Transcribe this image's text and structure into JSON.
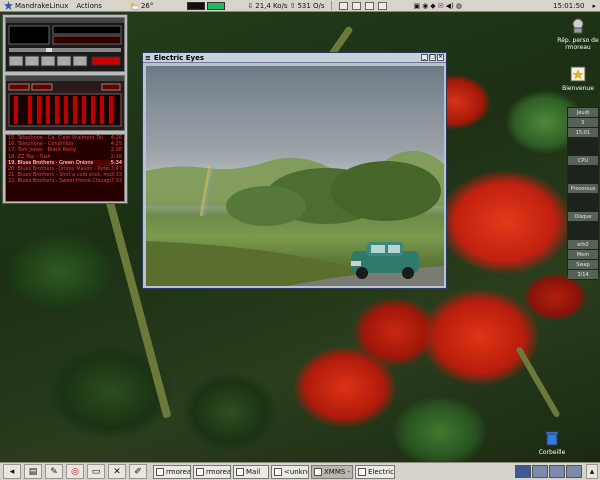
{
  "top_panel": {
    "menu_label": "MandrakeLinux",
    "actions_label": "Actions",
    "weather_temp": "26°",
    "net_down": "21,4 Ko/s",
    "net_up": "531 O/s",
    "clock": "15:01:50"
  },
  "xmms": {
    "playlist": [
      {
        "title": "15. Telephone - Ca, C'est Vraiment Toi",
        "time": "4:26"
      },
      {
        "title": "16. Telephone - Cendrillon",
        "time": "4:25"
      },
      {
        "title": "17. Tom Jones - Black Betty",
        "time": "2:38"
      },
      {
        "title": "18. ZZ Top - Tush",
        "time": "2:16"
      },
      {
        "title": "19. Blues Brothers - Green Onions",
        "time": "5:34"
      },
      {
        "title": "20. Blues Brothers - Jimmy Mason - Peter",
        "time": "3:47"
      },
      {
        "title": "21. Blues Brothers - Shot a cold stick, mon",
        "time": "3:33"
      },
      {
        "title": "22. Blues Brothers - Sweet Home Chicago",
        "time": "7:33"
      }
    ],
    "selected_index": 4
  },
  "electric_eyes": {
    "title": "Electric Eyes"
  },
  "desktop_icons": {
    "home_label": "Rép. perso de rmoreau",
    "welcome_label": "Bienvenue",
    "trash_label": "Corbeille"
  },
  "dock": {
    "date_day": "Jeudi",
    "date_num": "5",
    "date_time": "15:01",
    "cpu_label": "CPU",
    "proc_label": "Processus",
    "disk_label": "Disque",
    "eth_label": "eth0",
    "mem_label": "Mem",
    "swap_label": "Swap",
    "uptime": "3/14"
  },
  "taskbar": {
    "tasks": [
      {
        "label": "rmoreau@",
        "active": false
      },
      {
        "label": "rmoreau@",
        "active": false
      },
      {
        "label": "Mail",
        "active": false
      },
      {
        "label": "<unknown",
        "active": false
      },
      {
        "label": "XMMS - 1",
        "active": true
      },
      {
        "label": "Electric Ey",
        "active": false
      }
    ]
  },
  "colors": {
    "panel_bg": "#d8d4cc",
    "window_border": "#2a3a5a",
    "playlist_text": "#e04040",
    "playlist_selected": "#ffffff"
  }
}
